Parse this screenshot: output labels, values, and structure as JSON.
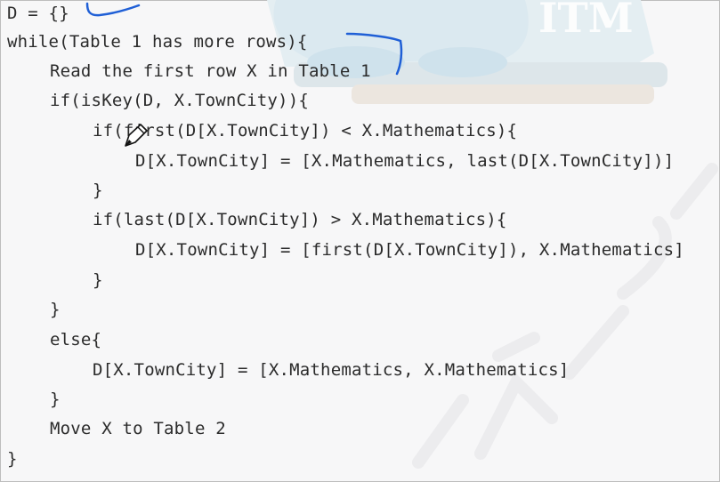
{
  "code": {
    "lines": [
      "D = {}",
      "while(Table 1 has more rows){",
      "Read the first row X in Table 1",
      "if(isKey(D, X.TownCity)){",
      "if(first(D[X.TownCity]) < X.Mathematics){",
      "D[X.TownCity] = [X.Mathematics, last(D[X.TownCity])]",
      "}",
      "if(last(D[X.TownCity]) > X.Mathematics){",
      "D[X.TownCity] = [first(D[X.TownCity]), X.Mathematics]",
      "}",
      "}",
      "else{",
      "D[X.TownCity] = [X.Mathematics, X.Mathematics]",
      "}",
      "Move X to Table 2",
      "}"
    ]
  },
  "annotations": {
    "pen_color": "#1f5fd6",
    "cursor_icon": "pencil-cursor-icon"
  },
  "background": {
    "watermark_text": "ITM",
    "illustration_color": "#dbe9f0"
  }
}
